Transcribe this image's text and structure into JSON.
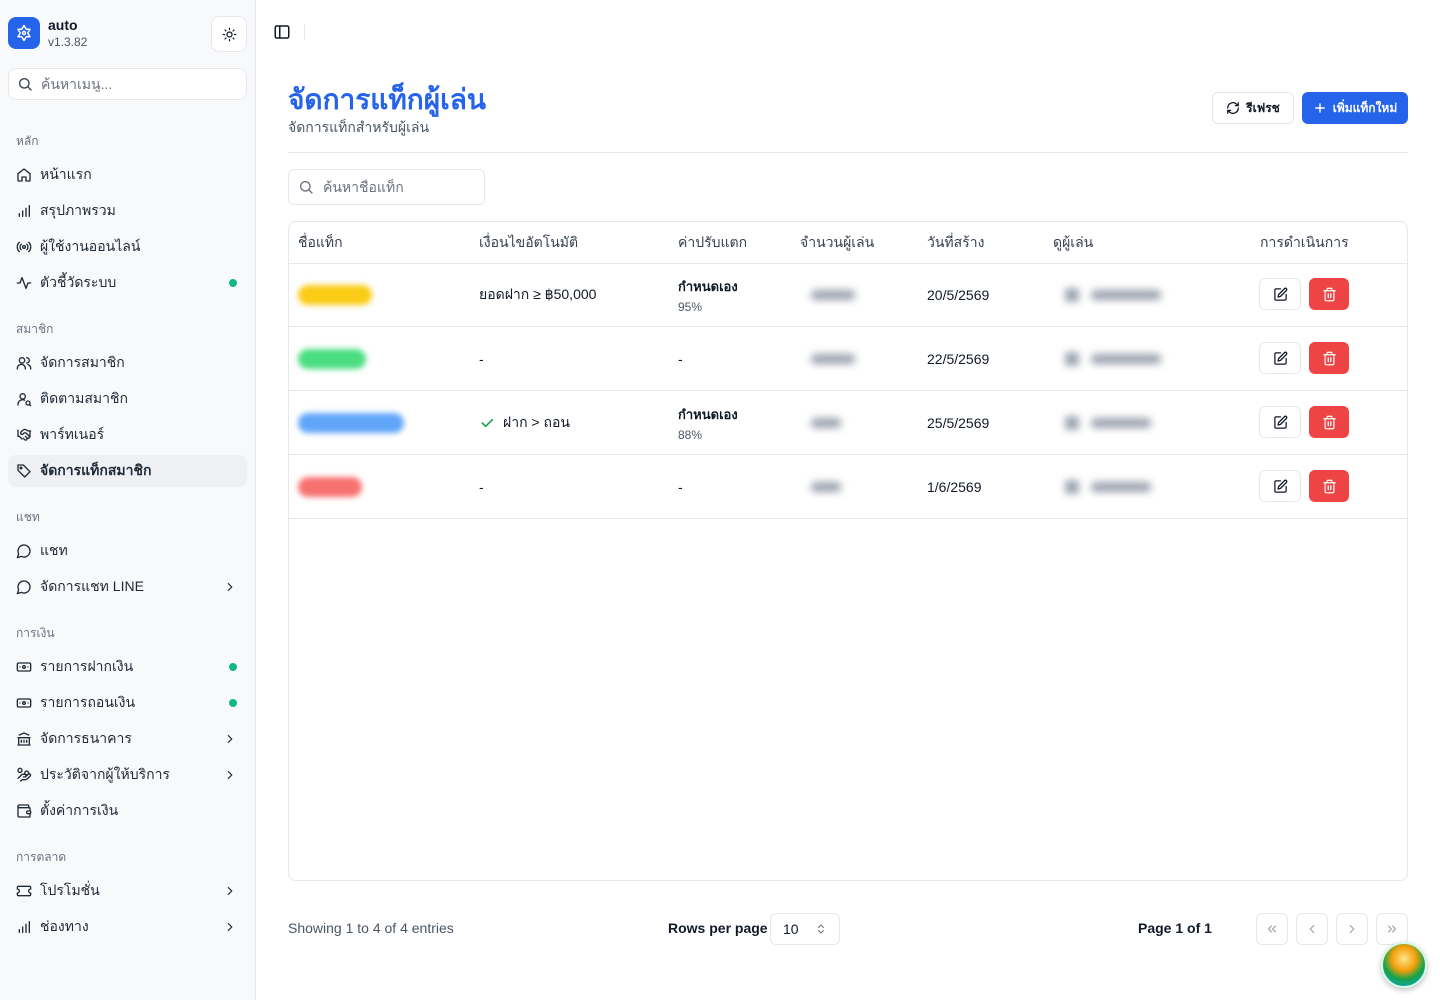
{
  "app": {
    "name": "auto",
    "version": "v1.3.82"
  },
  "sidebar": {
    "search_placeholder": "ค้นหาเมนู...",
    "groups": [
      {
        "label": "หลัก",
        "items": [
          {
            "label": "หน้าแรก",
            "icon": "home-icon"
          },
          {
            "label": "สรุปภาพรวม",
            "icon": "bar-chart-icon"
          },
          {
            "label": "ผู้ใช้งานออนไลน์",
            "icon": "broadcast-icon"
          },
          {
            "label": "ตัวชี้วัดระบบ",
            "icon": "activity-icon",
            "status": "online"
          }
        ]
      },
      {
        "label": "สมาชิก",
        "items": [
          {
            "label": "จัดการสมาชิก",
            "icon": "users-icon"
          },
          {
            "label": "ติดตามสมาชิก",
            "icon": "user-search-icon"
          },
          {
            "label": "พาร์ทเนอร์",
            "icon": "handshake-icon"
          },
          {
            "label": "จัดการแท็กสมาชิก",
            "icon": "tag-icon",
            "active": true
          }
        ]
      },
      {
        "label": "แชท",
        "items": [
          {
            "label": "แชท",
            "icon": "chat-icon"
          },
          {
            "label": "จัดการแชท LINE",
            "icon": "chat-icon",
            "expandable": true
          }
        ]
      },
      {
        "label": "การเงิน",
        "items": [
          {
            "label": "รายการฝากเงิน",
            "icon": "deposit-icon",
            "status": "online"
          },
          {
            "label": "รายการถอนเงิน",
            "icon": "withdraw-icon",
            "status": "online"
          },
          {
            "label": "จัดการธนาคาร",
            "icon": "bank-icon",
            "expandable": true
          },
          {
            "label": "ประวัติจากผู้ให้บริการ",
            "icon": "hand-coins-icon",
            "expandable": true
          },
          {
            "label": "ตั้งค่าการเงิน",
            "icon": "wallet-icon"
          }
        ]
      },
      {
        "label": "การตลาด",
        "items": [
          {
            "label": "โปรโมชั่น",
            "icon": "ticket-icon",
            "expandable": true
          },
          {
            "label": "ช่องทาง",
            "icon": "bar-chart-icon",
            "expandable": true
          }
        ]
      }
    ]
  },
  "header": {
    "title": "จัดการแท็กผู้เล่น",
    "subtitle": "จัดการแท็กสำหรับผู้เล่น",
    "refresh_label": "รีเฟรช",
    "add_label": "เพิ่มแท็กใหม่"
  },
  "search": {
    "placeholder": "ค้นหาชื่อแท็ก"
  },
  "table": {
    "columns": [
      "ชื่อแท็ก",
      "เงื่อนไขอัตโนมัติ",
      "ค่าปรับแตก",
      "จำนวนผู้เล่น",
      "วันที่สร้าง",
      "ดูผู้เล่น",
      "การดำเนินการ"
    ],
    "rows": [
      {
        "tag_color": "#facc15",
        "condition": "ยอดฝาก ≥ ฿50,000",
        "condition_check": false,
        "penalty_title": "กำหนดเอง",
        "penalty_value": "95%",
        "created": "20/5/2569"
      },
      {
        "tag_color": "#4ade80",
        "condition": "-",
        "condition_check": false,
        "penalty_title": "",
        "penalty_value": "-",
        "created": "22/5/2569"
      },
      {
        "tag_color": "#60a5fa",
        "condition": "ฝาก > ถอน",
        "condition_check": true,
        "penalty_title": "กำหนดเอง",
        "penalty_value": "88%",
        "created": "25/5/2569"
      },
      {
        "tag_color": "#f87171",
        "condition": "-",
        "condition_check": false,
        "penalty_title": "",
        "penalty_value": "-",
        "created": "1/6/2569"
      }
    ]
  },
  "pagination": {
    "showing": "Showing 1 to 4 of 4 entries",
    "rows_per_page_label": "Rows per page",
    "rows_per_page": "10",
    "page_label": "Page 1 of 1"
  },
  "colors": {
    "accent": "#2563eb",
    "danger": "#ef4444",
    "online": "#10b981"
  }
}
